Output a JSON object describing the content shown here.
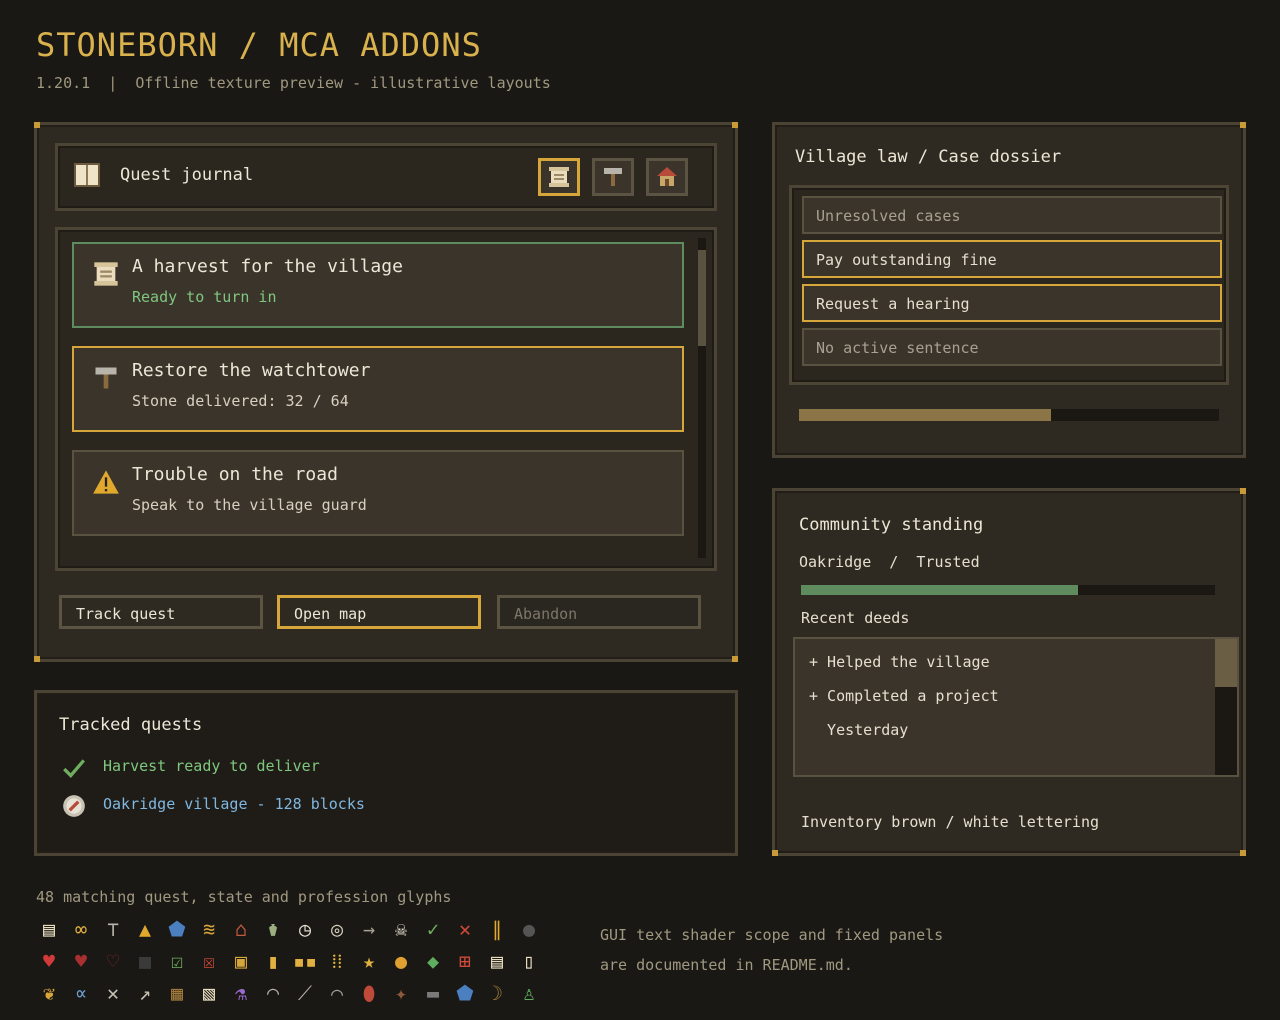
{
  "header": {
    "title": "STONEBORN / MCA ADDONS",
    "subtitle": "1.20.1  |  Offline texture preview - illustrative layouts"
  },
  "journal": {
    "title": "Quest journal",
    "tabs": [
      "scroll-icon",
      "hammer-icon",
      "house-icon"
    ],
    "quests": [
      {
        "title": "A harvest for the village",
        "status": "Ready to turn in",
        "icon": "scroll-icon"
      },
      {
        "title": "Restore the watchtower",
        "status": "Stone delivered: 32 / 64",
        "icon": "hammer-icon"
      },
      {
        "title": "Trouble on the road",
        "status": "Speak to the village guard",
        "icon": "warning-icon"
      }
    ],
    "buttons": {
      "track": "Track quest",
      "map": "Open map",
      "abandon": "Abandon"
    }
  },
  "tracked": {
    "title": "Tracked quests",
    "items": [
      {
        "text": "Harvest ready to deliver",
        "color": "#7fc77f",
        "icon": "check-icon"
      },
      {
        "text": "Oakridge village - 128 blocks",
        "color": "#7fb7e0",
        "icon": "compass-icon"
      }
    ]
  },
  "law": {
    "title": "Village law / Case dossier",
    "rows": [
      "Unresolved cases",
      "Pay outstanding fine",
      "Request a hearing",
      "No active sentence"
    ],
    "progress": 0.6
  },
  "standing": {
    "title": "Community standing",
    "village": "Oakridge  /  Trusted",
    "progress": 0.67,
    "deeds_label": "Recent deeds",
    "deeds": [
      "+ Helped the village",
      "+ Completed a project",
      "  Yesterday"
    ],
    "footer": "Inventory brown / white lettering"
  },
  "glyphs": {
    "caption": "48 matching quest, state and profession glyphs",
    "note_line1": "GUI text shader scope and fixed panels",
    "note_line2": "are documented in README.md."
  },
  "colors": {
    "accent": "#d9b24e",
    "ready": "#7fc77f",
    "link": "#7fb7e0",
    "progress_gold": "#8b7547",
    "progress_green": "#5f8c5f"
  }
}
